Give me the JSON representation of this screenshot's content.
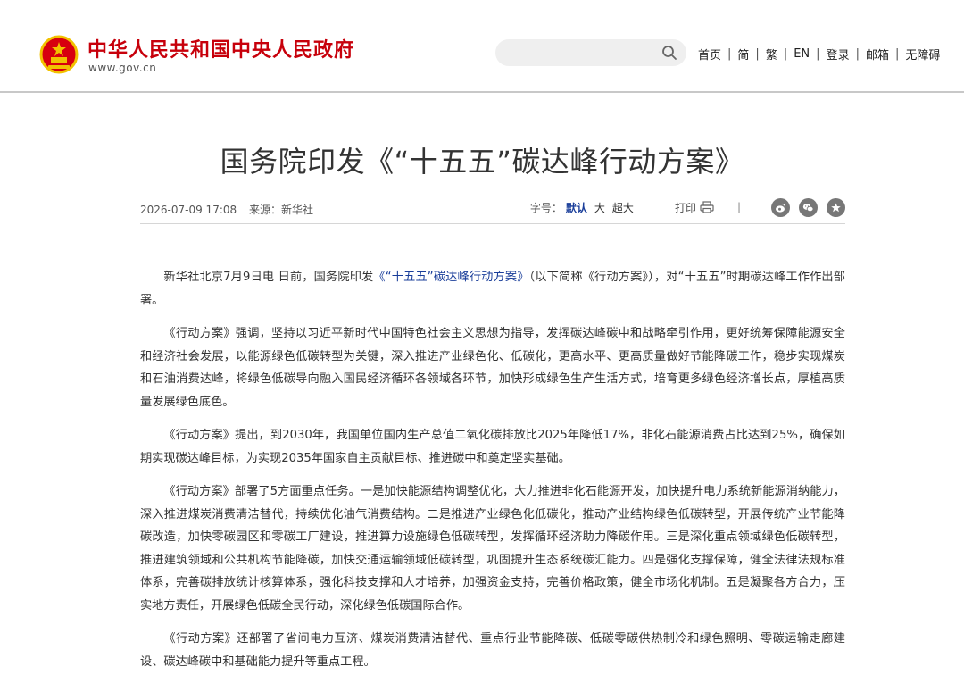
{
  "header": {
    "site_title": "中华人民共和国中央人民政府",
    "site_url": "www.gov.cn",
    "search": {
      "placeholder": ""
    },
    "nav": [
      "首页",
      "简",
      "繁",
      "EN",
      "登录",
      "邮箱",
      "无障碍"
    ]
  },
  "article": {
    "title": "国务院印发《“十五五”碳达峰行动方案》",
    "date": "2026-07-09 17:08",
    "source_label": "来源：",
    "source": "新华社",
    "font_size_label": "字号：",
    "font_sizes": [
      "默认",
      "大",
      "超大"
    ],
    "print_label": "打印",
    "share_icons": [
      "weibo-icon",
      "wechat-icon",
      "favorite-icon"
    ],
    "paragraphs": [
      {
        "pre": "新华社北京7月9日电 日前，国务院印发",
        "link": "《“十五五”碳达峰行动方案》",
        "post": "（以下简称《行动方案》），对“十五五”时期碳达峰工作作出部署。"
      },
      {
        "pre": "《行动方案》强调，坚持以习近平新时代中国特色社会主义思想为指导，发挥碳达峰碳中和战略牵引作用，更好统筹保障能源安全和经济社会发展，以能源绿色低碳转型为关键，深入推进产业绿色化、低碳化，更高水平、更高质量做好节能降碳工作，稳步实现煤炭和石油消费达峰，将绿色低碳导向融入国民经济循环各领域各环节，加快形成绿色生产生活方式，培育更多绿色经济增长点，厚植高质量发展绿色底色。",
        "link": "",
        "post": ""
      },
      {
        "pre": "《行动方案》提出，到2030年，我国单位国内生产总值二氧化碳排放比2025年降低17%，非化石能源消费占比达到25%，确保如期实现碳达峰目标，为实现2035年国家自主贡献目标、推进碳中和奠定坚实基础。",
        "link": "",
        "post": ""
      },
      {
        "pre": "《行动方案》部署了5方面重点任务。一是加快能源结构调整优化，大力推进非化石能源开发，加快提升电力系统新能源消纳能力，深入推进煤炭消费清洁替代，持续优化油气消费结构。二是推进产业绿色化低碳化，推动产业结构绿色低碳转型，开展传统产业节能降碳改造，加快零碳园区和零碳工厂建设，推进算力设施绿色低碳转型，发挥循环经济助力降碳作用。三是深化重点领域绿色低碳转型，推进建筑领域和公共机构节能降碳，加快交通运输领域低碳转型，巩固提升生态系统碳汇能力。四是强化支撑保障，健全法律法规标准体系，完善碳排放统计核算体系，强化科技支撑和人才培养，加强资金支持，完善价格政策，健全市场化机制。五是凝聚各方合力，压实地方责任，开展绿色低碳全民行动，深化绿色低碳国际合作。",
        "link": "",
        "post": ""
      },
      {
        "pre": "《行动方案》还部署了省间电力互济、煤炭消费清洁替代、重点行业节能降碳、低碳零碳供热制冷和绿色照明、零碳运输走廊建设、碳达峰碳中和基础能力提升等重点工程。",
        "link": "",
        "post": ""
      }
    ]
  },
  "colors": {
    "brand_red": "#c7000b",
    "link_blue": "#1a3e9a",
    "header_border": "#c8c8c8"
  }
}
